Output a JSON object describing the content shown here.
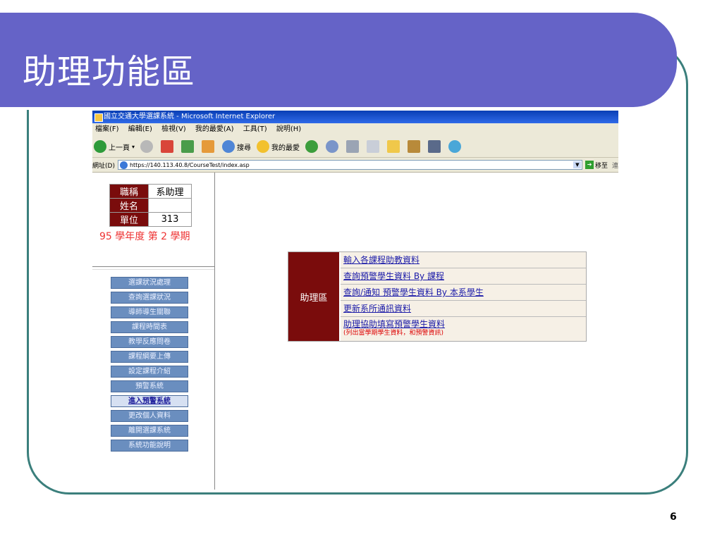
{
  "slide": {
    "title": "助理功能區",
    "page_number": "6"
  },
  "browser": {
    "window_title": "國立交通大學選課系統 - Microsoft Internet Explorer",
    "menu": [
      "檔案(F)",
      "編輯(E)",
      "檢視(V)",
      "我的最愛(A)",
      "工具(T)",
      "說明(H)"
    ],
    "toolbar": {
      "back_label": "上一頁",
      "search_label": "搜尋",
      "favorites_label": "我的最愛"
    },
    "address": {
      "label": "網址(D)",
      "url": "https://140.113.40.8/CourseTest/index.asp",
      "go_label": "移至",
      "links_label": "連"
    }
  },
  "user_info": {
    "title_key": "職稱",
    "title_value": "系助理",
    "name_key": "姓名",
    "name_value": "",
    "unit_key": "單位",
    "unit_value": "313",
    "semester": "95 學年度 第 2 學期"
  },
  "side_menu": [
    "選課狀況處理",
    "查詢選課狀況",
    "導師導生關聯",
    "課程時間表",
    "教學反應問卷",
    "課程綱要上傳",
    "設定課程介紹",
    "預警系統",
    "進入預警系統",
    "更改個人資料",
    "離開選課系統",
    "系統功能說明"
  ],
  "assistant_panel": {
    "label": "助理區",
    "items": [
      "輸入各課程助教資料",
      "查詢預警學生資料 By 課程",
      "查詢/通知 預警學生資料 By 本系學生",
      "更新系所通訊資料",
      "助理協助填寫預警學生資料"
    ],
    "note": "(列出當學期學生資料，和預警資訊)"
  },
  "colors": {
    "title_bar": "#6563c7",
    "frame_border": "#3b7f7c",
    "dark_red": "#7a0c0c",
    "menu_blue": "#6a8ebf"
  }
}
